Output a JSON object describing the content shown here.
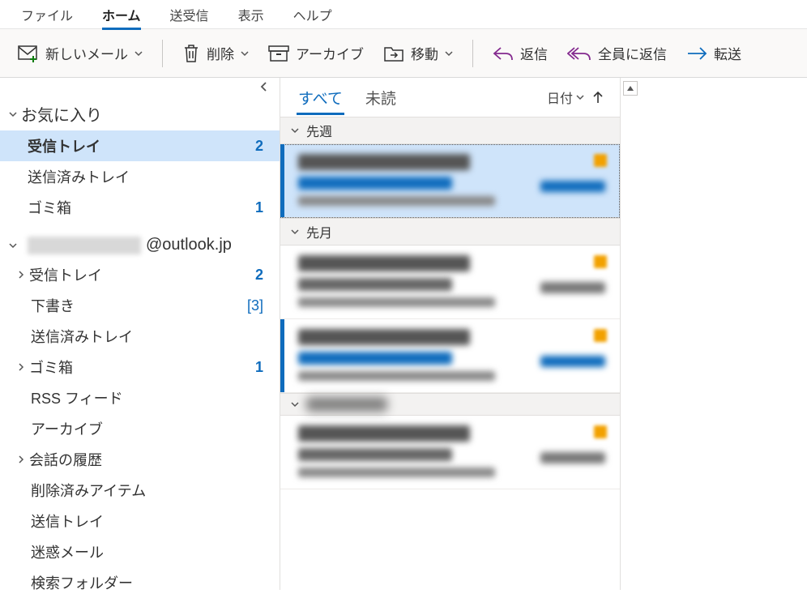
{
  "menubar": {
    "items": [
      {
        "label": "ファイル"
      },
      {
        "label": "ホーム",
        "active": true
      },
      {
        "label": "送受信"
      },
      {
        "label": "表示"
      },
      {
        "label": "ヘルプ"
      }
    ]
  },
  "toolbar": {
    "new_mail": "新しいメール",
    "delete": "削除",
    "archive": "アーカイブ",
    "move": "移動",
    "reply": "返信",
    "reply_all": "全員に返信",
    "forward": "転送"
  },
  "sidebar": {
    "favorites_label": "お気に入り",
    "favorites": [
      {
        "label": "受信トレイ",
        "badge": "2",
        "selected": true
      },
      {
        "label": "送信済みトレイ"
      },
      {
        "label": "ゴミ箱",
        "badge": "1"
      }
    ],
    "account_suffix": "@outlook.jp",
    "folders": [
      {
        "label": "受信トレイ",
        "badge": "2",
        "expandable": true
      },
      {
        "label": "下書き",
        "badge": "[3]",
        "bracket": true
      },
      {
        "label": "送信済みトレイ"
      },
      {
        "label": "ゴミ箱",
        "badge": "1",
        "expandable": true
      },
      {
        "label": "RSS フィード"
      },
      {
        "label": "アーカイブ"
      },
      {
        "label": "会話の履歴",
        "expandable": true
      },
      {
        "label": "削除済みアイテム"
      },
      {
        "label": "送信トレイ"
      },
      {
        "label": "迷惑メール"
      },
      {
        "label": "検索フォルダー"
      }
    ]
  },
  "msglist": {
    "tab_all": "すべて",
    "tab_unread": "未読",
    "sort_label": "日付",
    "groups": [
      {
        "label": "先週",
        "items": [
          {
            "selected": true,
            "unread": true,
            "blue": true
          }
        ]
      },
      {
        "label": "先月",
        "items": [
          {
            "blue": false
          },
          {
            "unread": true,
            "blue": true
          }
        ]
      },
      {
        "blurred": true,
        "items": [
          {
            "blue": false
          }
        ]
      }
    ]
  }
}
